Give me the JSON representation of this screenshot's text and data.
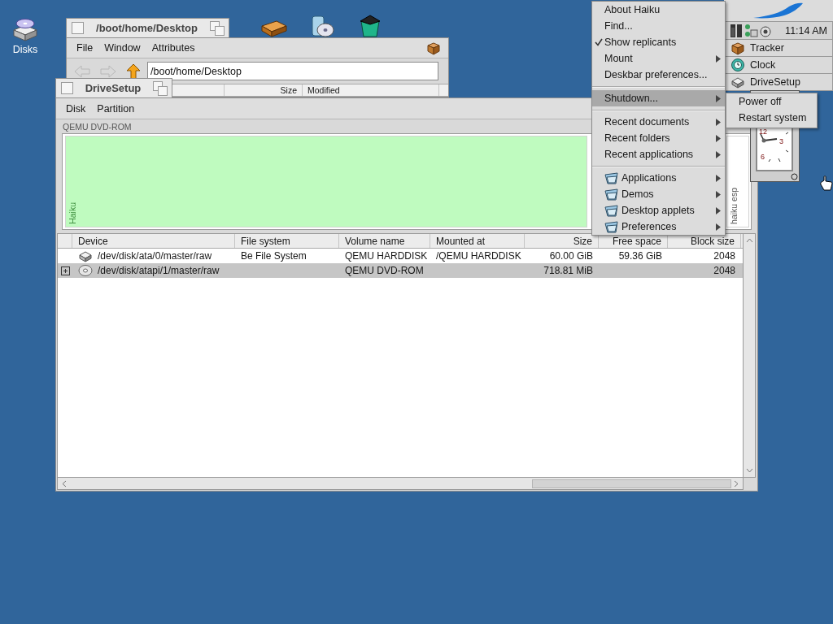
{
  "desktop_icons": [
    {
      "label": "Disks"
    }
  ],
  "tracker_window": {
    "title": "/boot/home/Desktop",
    "menus": [
      "File",
      "Window",
      "Attributes"
    ],
    "path": "/boot/home/Desktop",
    "columns": [
      "Size",
      "Modified"
    ]
  },
  "drivesetup_window": {
    "title": "DriveSetup",
    "menus": [
      "Disk",
      "Partition"
    ],
    "disk_label": "QEMU DVD-ROM",
    "partitions": [
      {
        "label": "Haiku",
        "color": "#bffbbf"
      },
      {
        "label": "haiku esp",
        "color": "#ffffff"
      }
    ],
    "table": {
      "columns": [
        "Device",
        "File system",
        "Volume name",
        "Mounted at",
        "Size",
        "Free space",
        "Block size"
      ],
      "rows": [
        {
          "kind": "harddisk",
          "expandable": false,
          "selected": false,
          "device": "/dev/disk/ata/0/master/raw",
          "file_system": "Be File System",
          "volume_name": "QEMU HARDDISK",
          "mounted_at": "/QEMU HARDDISK",
          "size": "60.00 GiB",
          "free_space": "59.36 GiB",
          "block_size": "2048"
        },
        {
          "kind": "optical",
          "expandable": true,
          "expanded": false,
          "selected": true,
          "device": "/dev/disk/atapi/1/master/raw",
          "volume_name": "QEMU DVD-ROM",
          "size": "718.81 MiB",
          "block_size": "2048"
        }
      ]
    }
  },
  "deskbar": {
    "time": "11:14 AM",
    "items": [
      {
        "label": "Tracker",
        "kind": "tracker"
      },
      {
        "label": "Clock",
        "kind": "clock"
      },
      {
        "label": "DriveSetup",
        "kind": "drivesetup"
      }
    ]
  },
  "clock": {
    "numerals": [
      "12",
      "3",
      "6"
    ]
  },
  "menu": {
    "items": [
      {
        "kind": "item",
        "label": "About Haiku",
        "checked": false,
        "submenu": false,
        "selected": false
      },
      {
        "kind": "item",
        "label": "Find...",
        "checked": false,
        "submenu": false,
        "selected": false
      },
      {
        "kind": "item",
        "label": "Show replicants",
        "checked": true,
        "submenu": false,
        "selected": false
      },
      {
        "kind": "item",
        "label": "Mount",
        "checked": false,
        "submenu": true,
        "selected": false
      },
      {
        "kind": "item",
        "label": "Deskbar preferences...",
        "checked": false,
        "submenu": false,
        "selected": false
      },
      {
        "kind": "separator"
      },
      {
        "kind": "item",
        "label": "Shutdown...",
        "checked": false,
        "submenu": true,
        "selected": true
      },
      {
        "kind": "separator"
      },
      {
        "kind": "item",
        "label": "Recent documents",
        "checked": false,
        "submenu": true,
        "selected": false
      },
      {
        "kind": "item",
        "label": "Recent folders",
        "checked": false,
        "submenu": true,
        "selected": false
      },
      {
        "kind": "item",
        "label": "Recent applications",
        "checked": false,
        "submenu": true,
        "selected": false
      },
      {
        "kind": "separator"
      },
      {
        "kind": "folder",
        "label": "Applications",
        "checked": false,
        "submenu": true,
        "selected": false
      },
      {
        "kind": "folder",
        "label": "Demos",
        "checked": false,
        "submenu": true,
        "selected": false
      },
      {
        "kind": "folder",
        "label": "Desktop applets",
        "checked": false,
        "submenu": true,
        "selected": false
      },
      {
        "kind": "folder",
        "label": "Preferences",
        "checked": false,
        "submenu": true,
        "selected": false
      }
    ]
  },
  "submenu": {
    "items": [
      {
        "kind": "item",
        "label": "Power off",
        "checked": false,
        "submenu": false,
        "selected": false
      },
      {
        "kind": "item",
        "label": "Restart system",
        "checked": false,
        "submenu": false,
        "selected": false
      }
    ]
  }
}
